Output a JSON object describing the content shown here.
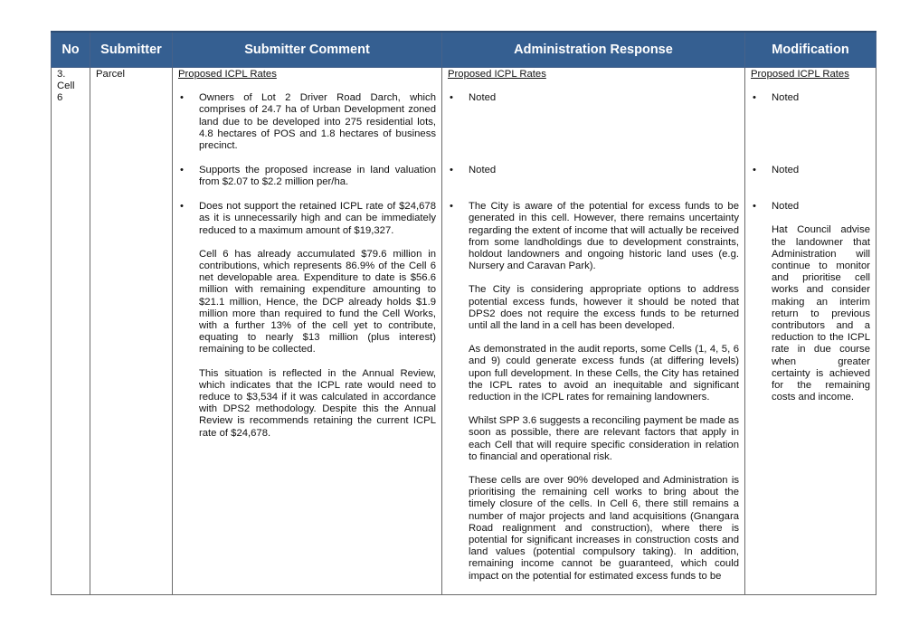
{
  "table": {
    "headers": [
      "No",
      "Submitter",
      "Submitter Comment",
      "Administration Response",
      "Modification"
    ],
    "row": {
      "no": "3.",
      "cell_label": "Cell",
      "cell_number": "6",
      "submitter": "Parcel",
      "comment": {
        "heading": "Proposed ICPL Rates",
        "items": [
          {
            "text": "Owners of Lot 2 Driver Road Darch, which comprises of 24.7 ha of Urban Development zoned land due to be developed into 275 residential lots, 4.8 hectares of POS and 1.8 hectares of business precinct.",
            "paragraphs": []
          },
          {
            "text": "Supports the proposed increase in land valuation from $2.07 to $2.2 million per/ha.",
            "paragraphs": []
          },
          {
            "text": "Does not support the retained ICPL rate of $24,678 as it is unnecessarily high and can be immediately reduced to a maximum amount of $19,327.",
            "paragraphs": [
              "Cell 6 has already accumulated $79.6 million in contributions, which represents 86.9% of the Cell 6 net developable area. Expenditure to date is $56.6 million with remaining expenditure amounting to $21.1 million, Hence, the DCP already holds $1.9 million more than required to fund the Cell Works, with a further 13% of the cell yet to contribute, equating to nearly $13 million (plus interest) remaining to be collected.",
              "This situation is reflected in the Annual Review, which indicates that the ICPL rate would need to reduce to $3,534 if it was calculated in accordance with DPS2 methodology. Despite this the Annual Review is recommends retaining the current ICPL rate of $24,678."
            ]
          }
        ]
      },
      "admin": {
        "heading": "Proposed ICPL Rates",
        "items": [
          {
            "text": "Noted",
            "paragraphs": []
          },
          {
            "text": "Noted",
            "paragraphs": []
          },
          {
            "text": "The City is aware of the potential for excess funds to be generated in this cell. However, there remains uncertainty regarding the extent of income that will actually be received from some landholdings due to development constraints, holdout landowners and ongoing historic land uses (e.g. Nursery and Caravan Park).",
            "paragraphs": [
              "The City is considering appropriate options to address potential excess funds, however it should be noted that DPS2 does not require the excess funds to be returned until all the land in a cell has been developed.",
              "As demonstrated in the audit reports, some Cells (1, 4, 5, 6 and 9) could generate excess funds (at differing levels) upon full development. In these Cells, the City has retained the ICPL rates to avoid an inequitable and significant reduction in the ICPL rates for remaining landowners.",
              "Whilst SPP 3.6 suggests a reconciling payment be made as soon as possible, there are relevant factors that apply in each Cell that will require specific consideration in relation to financial and operational risk.",
              "These cells are over 90% developed and Administration is prioritising the remaining cell works to bring about the timely closure of the cells. In Cell 6, there still remains a number of major projects and land acquisitions (Gnangara Road realignment and construction), where there is potential for significant increases in construction costs and land values (potential compulsory taking). In addition, remaining income cannot be guaranteed, which could impact on the potential for estimated excess funds to be"
            ]
          }
        ]
      },
      "modification": {
        "heading": "Proposed ICPL Rates",
        "items": [
          {
            "text": "Noted",
            "paragraphs": []
          },
          {
            "text": "Noted",
            "paragraphs": []
          },
          {
            "text": "Noted",
            "paragraphs": [
              "Hat Council advise the landowner that Administration will continue to monitor and prioritise cell works and consider making an interim return to previous contributors and a reduction to the ICPL rate in due course when greater certainty is achieved for the remaining costs and income."
            ]
          }
        ]
      }
    }
  },
  "bullet_glyph": "•"
}
